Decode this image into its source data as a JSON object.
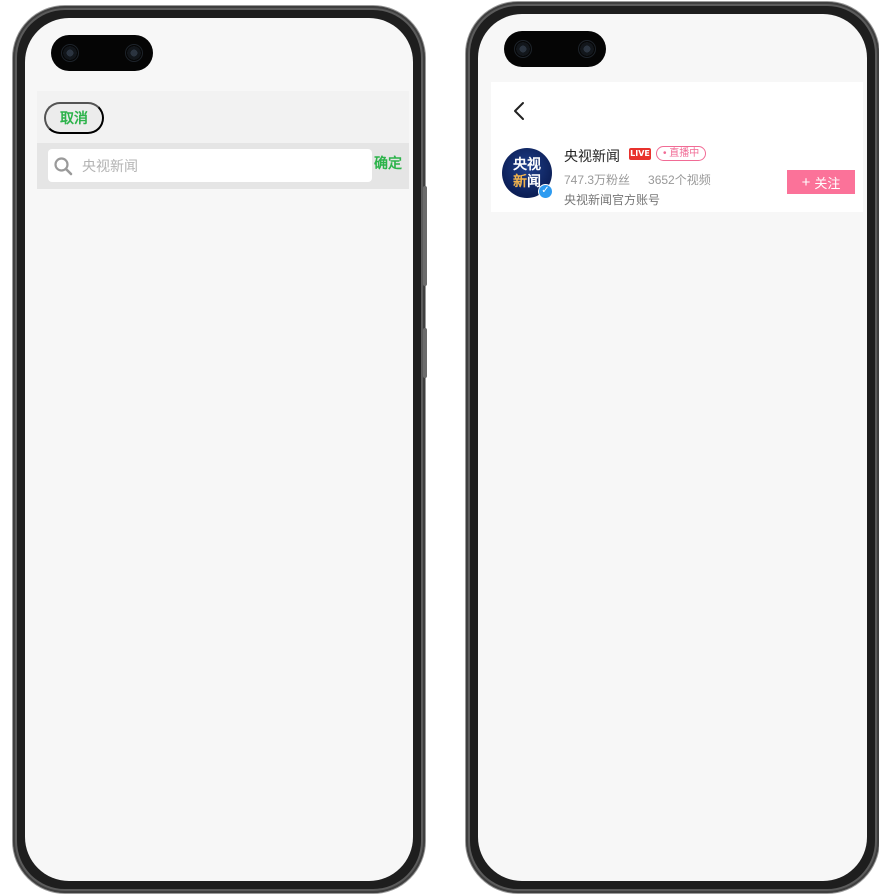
{
  "left_screen": {
    "cancel_label": "取消",
    "search": {
      "placeholder": "央视新闻",
      "value": ""
    },
    "confirm_label": "确定",
    "icons": {
      "search": "search-icon"
    }
  },
  "right_screen": {
    "channel": {
      "name": "央视新闻",
      "live_badge": "LIVE",
      "live_status": "• 直播中",
      "followers": "747.3万粉丝",
      "videos": "3652个视频",
      "description": "央视新闻官方账号",
      "avatar_text_top": "央视",
      "avatar_text_bottom_1": "新",
      "avatar_text_bottom_2": "闻"
    },
    "follow_label": "关注",
    "follow_plus": "+",
    "icons": {
      "back": "back-icon",
      "verified": "verified-icon"
    }
  },
  "colors": {
    "accent_green": "#2cb34a",
    "follow_pink": "#fb7299",
    "live_red": "#e8322d"
  }
}
